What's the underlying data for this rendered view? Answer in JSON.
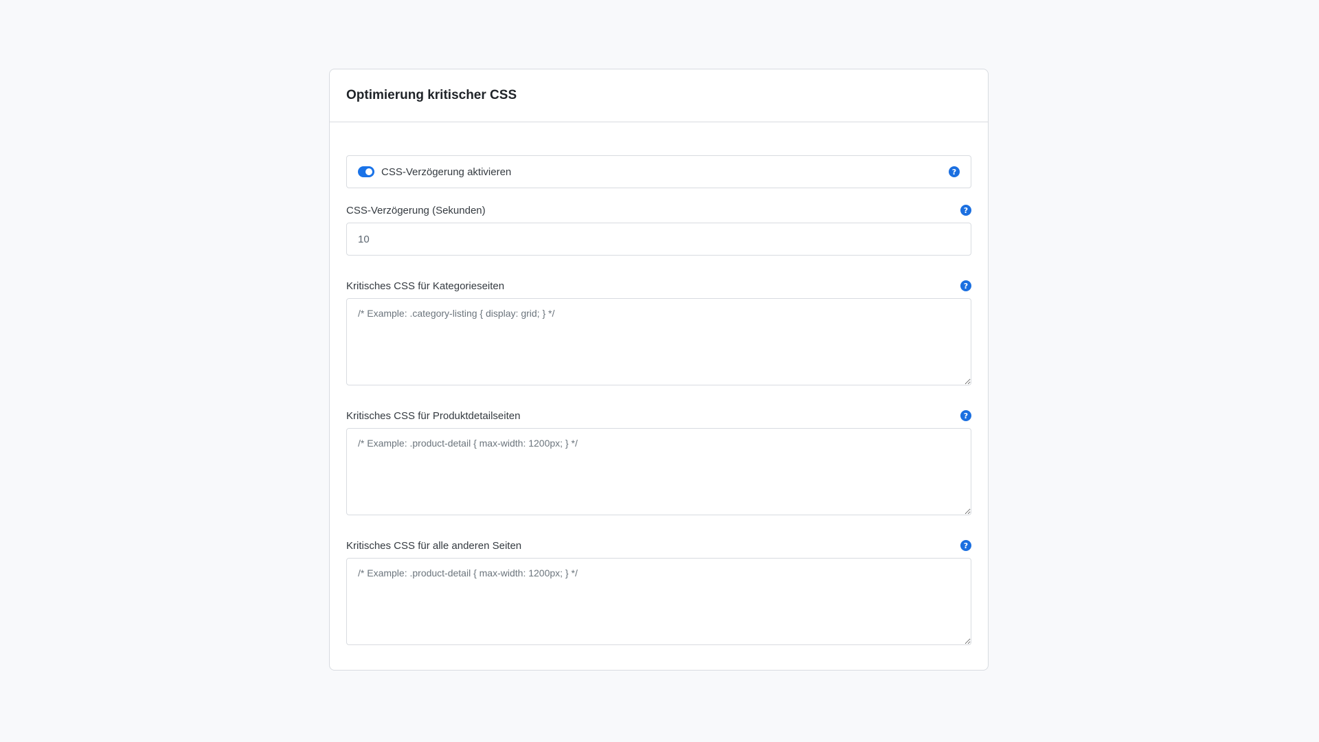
{
  "card": {
    "title": "Optimierung kritischer CSS"
  },
  "toggle": {
    "label": "CSS-Verzögerung aktivieren",
    "checked": true,
    "help_icon": "question-circle-icon"
  },
  "fields": [
    {
      "label": "CSS-Verzögerung (Sekunden)",
      "value": "10",
      "help_icon": "question-circle-icon"
    },
    {
      "label": "Kritisches CSS für Kategorieseiten",
      "placeholder": "/* Example: .category-listing { display: grid; } */",
      "help_icon": "question-circle-icon"
    },
    {
      "label": "Kritisches CSS für Produktdetailseiten",
      "placeholder": "/* Example: .product-detail { max-width: 1200px; } */",
      "help_icon": "question-circle-icon"
    },
    {
      "label": "Kritisches CSS für alle anderen Seiten",
      "placeholder": "/* Example: .product-detail { max-width: 1200px; } */",
      "help_icon": "question-circle-icon"
    }
  ],
  "help_glyph": "?",
  "colors": {
    "accent": "#1b6fe0",
    "background": "#f8f9fb",
    "border": "#d8dbe0"
  }
}
